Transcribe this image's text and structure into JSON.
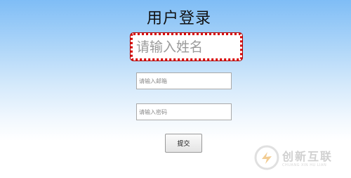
{
  "page": {
    "title": "用户登录"
  },
  "form": {
    "name_placeholder": "请输入姓名",
    "email_placeholder": "请输入邮箱",
    "password_placeholder": "请输入密码",
    "submit_label": "提交"
  },
  "watermark": {
    "brand": "创新互联",
    "subtitle": "CHUANG XIN HU LIAN"
  },
  "colors": {
    "focus_border": "#d80000",
    "background_top": "#7fbdf6",
    "background_bottom": "#ffffff"
  },
  "icons": {
    "watermark_logo": "brand-logo-icon"
  }
}
